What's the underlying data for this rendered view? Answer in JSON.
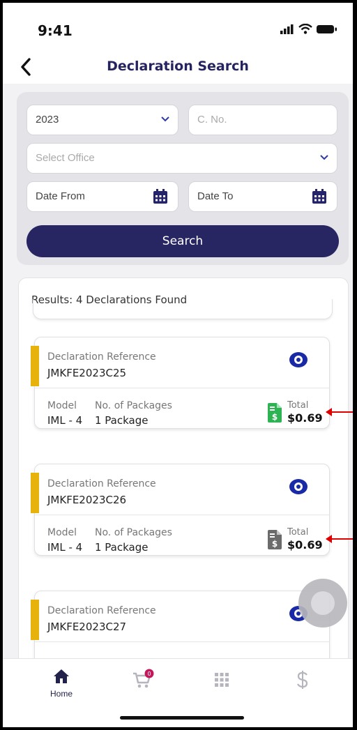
{
  "status": {
    "time": "9:41"
  },
  "header": {
    "title": "Declaration Search"
  },
  "search": {
    "year": "2023",
    "cno_placeholder": "C. No.",
    "office_placeholder": "Select Office",
    "date_from": "Date From",
    "date_to": "Date To",
    "button": "Search"
  },
  "results": {
    "summary": "Results: 4 Declarations Found",
    "items": [
      {
        "ref_label": "Declaration Reference",
        "ref": "JMKFE2023C25",
        "model_label": "Model",
        "model": "IML - 4",
        "pkg_label": "No. of Packages",
        "pkg": "1 Package",
        "total_label": "Total",
        "total": "$0.69",
        "doc_color": "#2eb352"
      },
      {
        "ref_label": "Declaration Reference",
        "ref": "JMKFE2023C26",
        "model_label": "Model",
        "model": "IML - 4",
        "pkg_label": "No. of Packages",
        "pkg": "1 Package",
        "total_label": "Total",
        "total": "$0.69",
        "doc_color": "#6b6b6b"
      },
      {
        "ref_label": "Declaration Reference",
        "ref": "JMKFE2023C27"
      }
    ]
  },
  "tabs": {
    "home": "Home",
    "cart_badge": "0"
  },
  "colors": {
    "brand": "#272562",
    "accent": "#e8b20c",
    "eye": "#1a2aa6",
    "arrow": "#e00000"
  }
}
